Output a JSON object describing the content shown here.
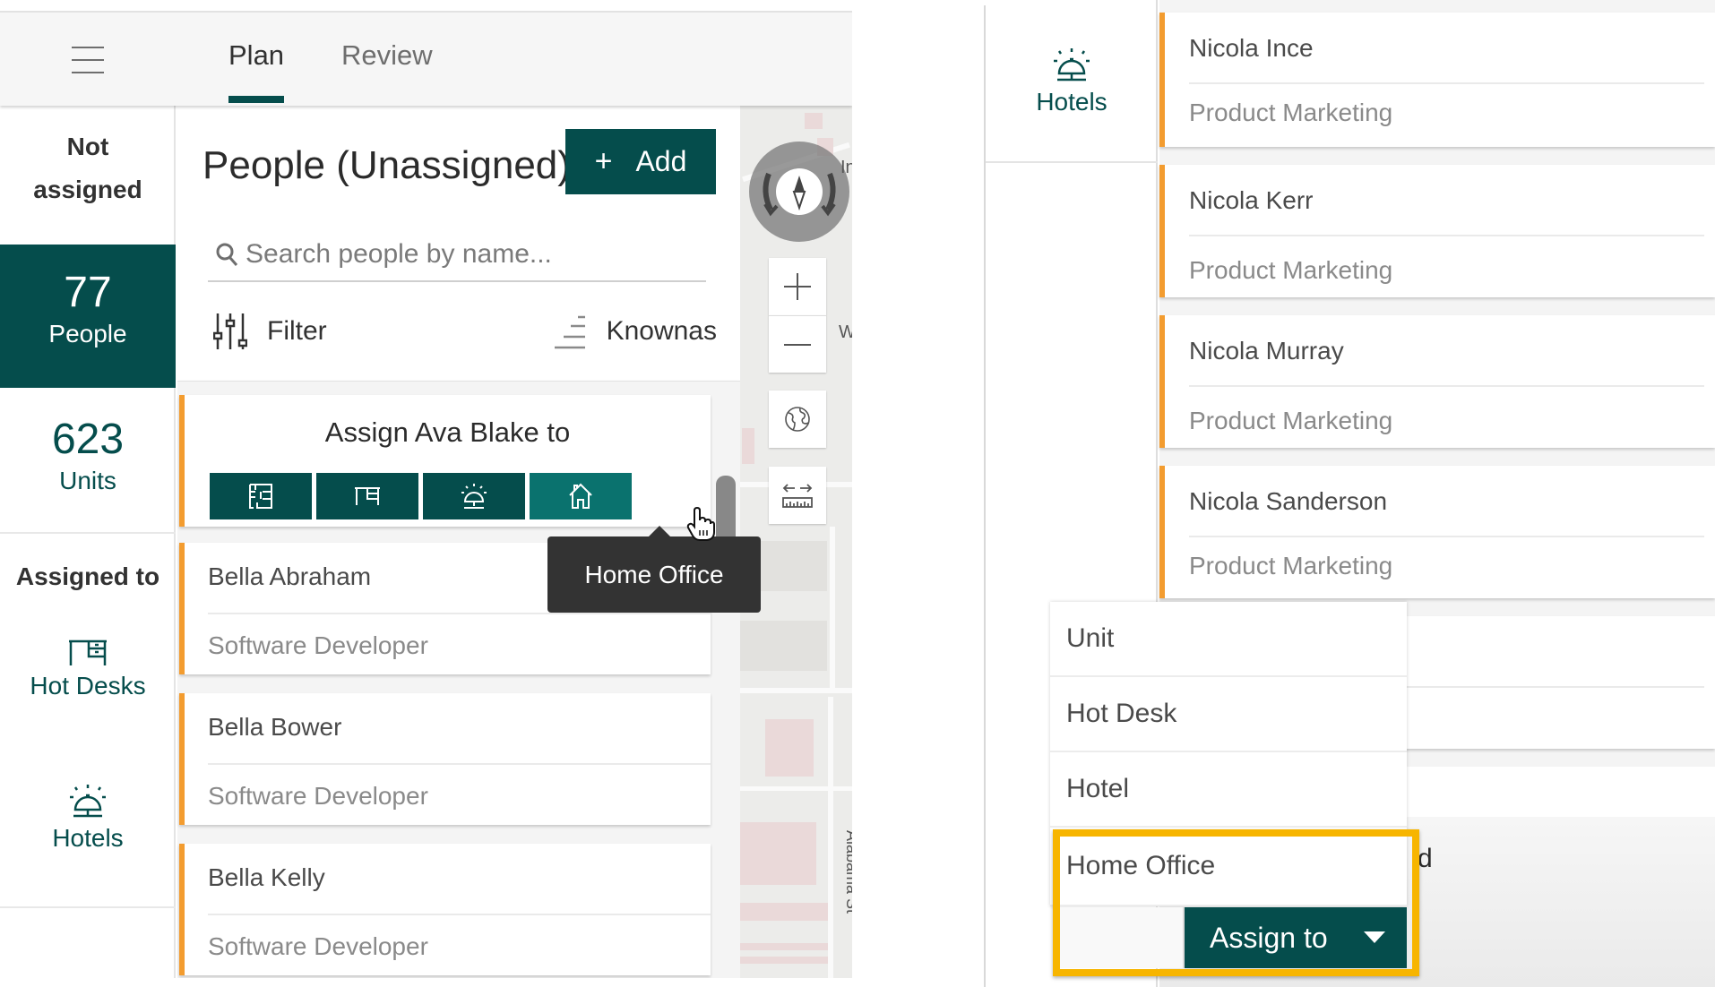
{
  "left_app": {
    "header": {
      "menu_icon": "hamburger-menu-icon",
      "tabs": [
        {
          "label": "Plan",
          "active": true
        },
        {
          "label": "Review",
          "active": false
        }
      ]
    },
    "sidebar": {
      "not_assigned_line1": "Not",
      "not_assigned_line2": "assigned",
      "people_count": "77",
      "people_label": "People",
      "units_count": "623",
      "units_label": "Units",
      "assigned_to_label": "Assigned to",
      "hot_desks_label": "Hot Desks",
      "hotels_label": "Hotels"
    },
    "list_panel": {
      "title": "People (Unassigned)",
      "add_button": {
        "plus": "+",
        "label": "Add"
      },
      "search": {
        "placeholder": "Search people by name...",
        "value": ""
      },
      "filter_label": "Filter",
      "sort_label": "Knownas",
      "assign_card": {
        "title": "Assign Ava Blake to",
        "options": [
          {
            "name": "Unit",
            "icon": "floor-plan-icon"
          },
          {
            "name": "Hot Desk",
            "icon": "desk-icon"
          },
          {
            "name": "Hotel",
            "icon": "service-bell-icon"
          },
          {
            "name": "Home Office",
            "icon": "home-icon",
            "hovered": true
          }
        ]
      },
      "people": [
        {
          "name": "Bella Abraham",
          "role": "Software Developer"
        },
        {
          "name": "Bella Bower",
          "role": "Software Developer"
        },
        {
          "name": "Bella Kelly",
          "role": "Software Developer"
        }
      ],
      "tooltip": "Home Office"
    },
    "map": {
      "labels": {
        "top": "In",
        "mid": "W",
        "street": "Alabama St"
      },
      "controls": [
        "compass",
        "zoom-in",
        "zoom-out",
        "basemap",
        "measure"
      ]
    }
  },
  "right_app": {
    "sidebar": {
      "hotels_label": "Hotels"
    },
    "people": [
      {
        "name": "Nicola Ince",
        "role": "Product Marketing"
      },
      {
        "name": "Nicola Kerr",
        "role": "Product Marketing"
      },
      {
        "name": "Nicola Murray",
        "role": "Product Marketing"
      },
      {
        "name": "Nicola Sanderson",
        "role": "Product Marketing"
      }
    ],
    "partial_text": "d",
    "dropdown": {
      "items": [
        "Unit",
        "Hot Desk",
        "Hotel",
        "Home Office"
      ],
      "highlighted": "Home Office"
    },
    "assign_button_label": "Assign to"
  },
  "colors": {
    "brand": "#054d4c",
    "brand_hover": "#0a726e",
    "accent_orange": "#f39c2f",
    "highlight": "#f7b500",
    "tooltip_bg": "#333333"
  }
}
